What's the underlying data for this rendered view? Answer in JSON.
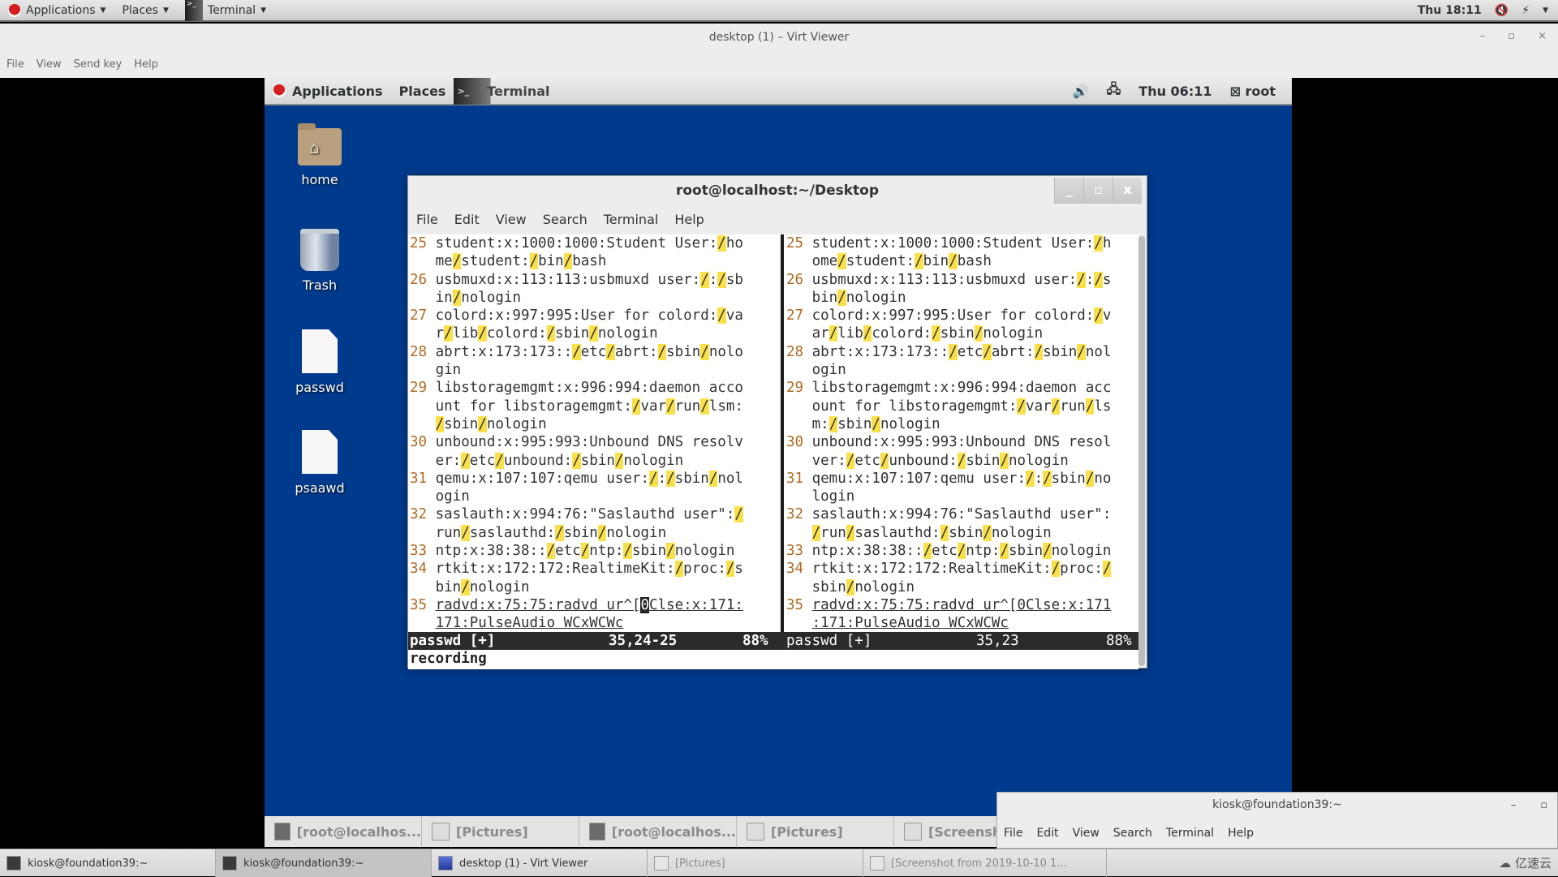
{
  "host_topbar": {
    "applications": "Applications",
    "places": "Places",
    "terminal": "Terminal",
    "clock": "Thu 18:11"
  },
  "virt_viewer": {
    "title": "desktop (1) – Virt Viewer",
    "controls": {
      "minimize": "–",
      "maximize": "▫",
      "close": "×"
    },
    "menu": [
      "File",
      "View",
      "Send key",
      "Help"
    ]
  },
  "guest": {
    "panel": {
      "applications": "Applications",
      "places": "Places",
      "terminal": "Terminal",
      "clock": "Thu 06:11",
      "user": "root"
    },
    "desktop_icons": [
      {
        "label": "home",
        "icon": "home-folder-icon"
      },
      {
        "label": "Trash",
        "icon": "trash-icon"
      },
      {
        "label": "passwd",
        "icon": "file-icon"
      },
      {
        "label": "psaawd",
        "icon": "file-icon"
      }
    ],
    "terminal": {
      "title": "root@localhost:~/Desktop",
      "controls": {
        "minimize": "_",
        "maximize": "▫",
        "close": "x"
      },
      "menu": [
        "File",
        "Edit",
        "View",
        "Search",
        "Terminal",
        "Help"
      ],
      "left_pane": [
        {
          "n": "25",
          "segs": [
            "student:x:1000:1000:Student User:",
            "/",
            "ho"
          ]
        },
        {
          "n": "",
          "segs": [
            "me",
            "/",
            "student:",
            "/",
            "bin",
            "/",
            "bash"
          ]
        },
        {
          "n": "26",
          "segs": [
            "usbmuxd:x:113:113:usbmuxd user:",
            "/",
            ":",
            "/",
            "sb"
          ]
        },
        {
          "n": "",
          "segs": [
            "in",
            "/",
            "nologin"
          ]
        },
        {
          "n": "27",
          "segs": [
            "colord:x:997:995:User for colord:",
            "/",
            "va"
          ]
        },
        {
          "n": "",
          "segs": [
            "r",
            "/",
            "lib",
            "/",
            "colord:",
            "/",
            "sbin",
            "/",
            "nologin"
          ]
        },
        {
          "n": "28",
          "segs": [
            "abrt:x:173:173::",
            "/",
            "etc",
            "/",
            "abrt:",
            "/",
            "sbin",
            "/",
            "nolo"
          ]
        },
        {
          "n": "",
          "segs": [
            "gin"
          ]
        },
        {
          "n": "29",
          "segs": [
            "libstoragemgmt:x:996:994:daemon acco"
          ]
        },
        {
          "n": "",
          "segs": [
            "unt for libstoragemgmt:",
            "/",
            "var",
            "/",
            "run",
            "/",
            "lsm:"
          ]
        },
        {
          "n": "",
          "segs": [
            "",
            "/",
            "sbin",
            "/",
            "nologin"
          ]
        },
        {
          "n": "30",
          "segs": [
            "unbound:x:995:993:Unbound DNS resolv"
          ]
        },
        {
          "n": "",
          "segs": [
            "er:",
            "/",
            "etc",
            "/",
            "unbound:",
            "/",
            "sbin",
            "/",
            "nologin"
          ]
        },
        {
          "n": "31",
          "segs": [
            "qemu:x:107:107:qemu user:",
            "/",
            ":",
            "/",
            "sbin",
            "/",
            "nol"
          ]
        },
        {
          "n": "",
          "segs": [
            "ogin"
          ]
        },
        {
          "n": "32",
          "segs": [
            "saslauth:x:994:76:\"Saslauthd user\":",
            "/"
          ]
        },
        {
          "n": "",
          "segs": [
            "run",
            "/",
            "saslauthd:",
            "/",
            "sbin",
            "/",
            "nologin"
          ]
        },
        {
          "n": "33",
          "segs": [
            "ntp:x:38:38::",
            "/",
            "etc",
            "/",
            "ntp:",
            "/",
            "sbin",
            "/",
            "nologin"
          ]
        },
        {
          "n": "34",
          "segs": [
            "rtkit:x:172:172:RealtimeKit:",
            "/",
            "proc:",
            "/",
            "s"
          ]
        },
        {
          "n": "",
          "segs": [
            "bin",
            "/",
            "nologin"
          ]
        },
        {
          "n": "35",
          "underline": true,
          "segs": [
            "radvd:x:75:75:radvd ur^[",
            "0",
            "Clse:x:171:"
          ],
          "cursor_seg": 1
        },
        {
          "n": "",
          "underline": true,
          "segs": [
            "171:PulseAudio WCxWCWc"
          ]
        }
      ],
      "right_pane": [
        {
          "n": "25",
          "segs": [
            "student:x:1000:1000:Student User:",
            "/",
            "h"
          ]
        },
        {
          "n": "",
          "segs": [
            "ome",
            "/",
            "student:",
            "/",
            "bin",
            "/",
            "bash"
          ]
        },
        {
          "n": "26",
          "segs": [
            "usbmuxd:x:113:113:usbmuxd user:",
            "/",
            ":",
            "/",
            "s"
          ]
        },
        {
          "n": "",
          "segs": [
            "bin",
            "/",
            "nologin"
          ]
        },
        {
          "n": "27",
          "segs": [
            "colord:x:997:995:User for colord:",
            "/",
            "v"
          ]
        },
        {
          "n": "",
          "segs": [
            "ar",
            "/",
            "lib",
            "/",
            "colord:",
            "/",
            "sbin",
            "/",
            "nologin"
          ]
        },
        {
          "n": "28",
          "segs": [
            "abrt:x:173:173::",
            "/",
            "etc",
            "/",
            "abrt:",
            "/",
            "sbin",
            "/",
            "nol"
          ]
        },
        {
          "n": "",
          "segs": [
            "ogin"
          ]
        },
        {
          "n": "29",
          "segs": [
            "libstoragemgmt:x:996:994:daemon acc"
          ]
        },
        {
          "n": "",
          "segs": [
            "ount for libstoragemgmt:",
            "/",
            "var",
            "/",
            "run",
            "/",
            "ls"
          ]
        },
        {
          "n": "",
          "segs": [
            "m:",
            "/",
            "sbin",
            "/",
            "nologin"
          ]
        },
        {
          "n": "30",
          "segs": [
            "unbound:x:995:993:Unbound DNS resol"
          ]
        },
        {
          "n": "",
          "segs": [
            "ver:",
            "/",
            "etc",
            "/",
            "unbound:",
            "/",
            "sbin",
            "/",
            "nologin"
          ]
        },
        {
          "n": "31",
          "segs": [
            "qemu:x:107:107:qemu user:",
            "/",
            ":",
            "/",
            "sbin",
            "/",
            "no"
          ]
        },
        {
          "n": "",
          "segs": [
            "login"
          ]
        },
        {
          "n": "32",
          "segs": [
            "saslauth:x:994:76:\"Saslauthd user\":"
          ]
        },
        {
          "n": "",
          "segs": [
            "",
            "/",
            "run",
            "/",
            "saslauthd:",
            "/",
            "sbin",
            "/",
            "nologin"
          ]
        },
        {
          "n": "33",
          "segs": [
            "ntp:x:38:38::",
            "/",
            "etc",
            "/",
            "ntp:",
            "/",
            "sbin",
            "/",
            "nologin"
          ]
        },
        {
          "n": "34",
          "segs": [
            "rtkit:x:172:172:RealtimeKit:",
            "/",
            "proc:",
            "/"
          ]
        },
        {
          "n": "",
          "segs": [
            "sbin",
            "/",
            "nologin"
          ]
        },
        {
          "n": "35",
          "underline": true,
          "segs": [
            "radvd:x:75:75:radvd ur^[0Clse:x:171"
          ]
        },
        {
          "n": "",
          "underline": true,
          "segs": [
            ":171:PulseAudio WCxWCWc"
          ]
        }
      ],
      "status_left": {
        "file": "passwd [+]",
        "position": "35,24-25",
        "percent": "88%"
      },
      "status_right": {
        "file": "passwd [+]",
        "position": "35,23",
        "percent": "88%"
      },
      "command_line": "recording"
    },
    "taskbar": [
      {
        "label": "[root@localhos...",
        "icon": "terminal-icon"
      },
      {
        "label": "[Pictures]",
        "icon": "pictures-icon"
      },
      {
        "label": "[root@localhos...",
        "icon": "terminal-icon"
      },
      {
        "label": "[Pictures]",
        "icon": "pictures-icon"
      },
      {
        "label": "[Screensh",
        "icon": "screenshot-icon"
      }
    ]
  },
  "kiosk_window": {
    "title": "kiosk@foundation39:~",
    "controls": {
      "minimize": "–",
      "maximize": "▫"
    },
    "menu": [
      "File",
      "Edit",
      "View",
      "Search",
      "Terminal",
      "Help"
    ]
  },
  "host_taskbar": [
    {
      "label": "kiosk@foundation39:~",
      "icon": "terminal-icon",
      "state": "normal"
    },
    {
      "label": "kiosk@foundation39:~",
      "icon": "terminal-icon",
      "state": "active"
    },
    {
      "label": "desktop (1) - Virt Viewer",
      "icon": "virt-viewer-icon",
      "state": "normal"
    },
    {
      "label": "[Pictures]",
      "icon": "pictures-icon",
      "state": "dim"
    },
    {
      "label": "[Screenshot from 2019-10-10 1...",
      "icon": "screenshot-icon",
      "state": "dim"
    }
  ],
  "watermark": "亿速云"
}
